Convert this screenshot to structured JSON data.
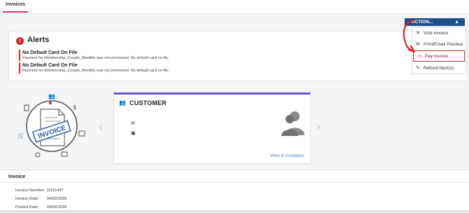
{
  "tabs": {
    "active": "Invoices"
  },
  "alerts": {
    "title": "Alerts",
    "icon": "exclamation-icon",
    "items": [
      {
        "title": "No Default Card On File",
        "message": "Payment for Membership_Couple_Monthly was not processed: No default card on file."
      },
      {
        "title": "No Default Card On File",
        "message": "Payment for Membership_Couple_Monthly was not processed: No default card on file."
      }
    ]
  },
  "actions": {
    "button_label": "ACTION...",
    "menu": [
      {
        "label": "Void Invoice",
        "icon": "close-icon"
      },
      {
        "label": "Print/Email Preview",
        "icon": "envelope-icon"
      },
      {
        "label": "Pay Invoice",
        "icon": "credit-card-icon",
        "highlighted": true
      },
      {
        "label": "Refund Item(s)",
        "icon": "edit-icon"
      }
    ]
  },
  "illustration": {
    "stamp_text": "INVOICE"
  },
  "customer": {
    "title": "CUSTOMER",
    "link": "View in Contacts"
  },
  "invoice": {
    "section_title": "Invoice",
    "rows": [
      {
        "label": "Invoice Number:",
        "value": "11111437"
      },
      {
        "label": "Invoice Date:",
        "value": "04/02/2026"
      },
      {
        "label": "Posted Date:",
        "value": "04/02/2026"
      }
    ]
  },
  "colors": {
    "accent": "#1f4e8c",
    "alert": "#d9252b",
    "card_top": "#6b55c9",
    "link": "#3b7dd8",
    "tab": "#d6336c"
  }
}
